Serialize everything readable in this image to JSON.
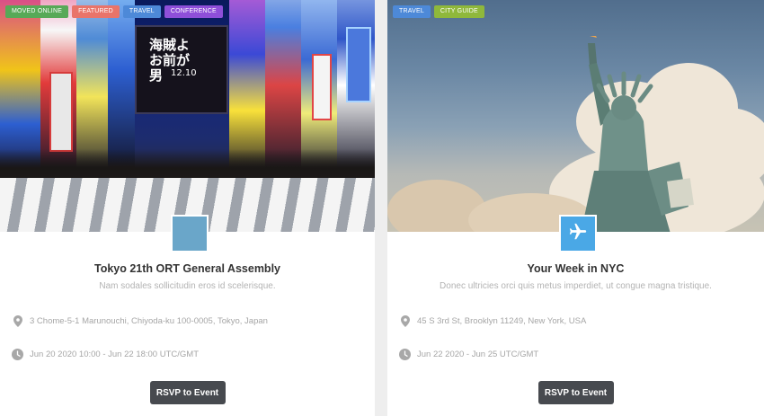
{
  "cards": [
    {
      "tags": [
        {
          "label": "MOVED ONLINE",
          "color": "#57a957"
        },
        {
          "label": "FEATURED",
          "color": "#e9746a"
        },
        {
          "label": "TRAVEL",
          "color": "#4d89d8"
        },
        {
          "label": "CONFERENCE",
          "color": "#8e4fd9"
        }
      ],
      "image_text": {
        "line1": "海賊よ",
        "line2": "お前が",
        "line3": "男",
        "number": "12.10"
      },
      "avatar_color": "#6aa6c9",
      "title": "Tokyo 21th ORT General Assembly",
      "subtitle": "Nam sodales sollicitudin eros id scelerisque.",
      "location": "3 Chome-5-1 Marunouchi, Chiyoda-ku 100-0005, Tokyo, Japan",
      "date": "Jun 20 2020 10:00 - Jun 22 18:00 UTC/GMT",
      "button_label": "RSVP to Event"
    },
    {
      "tags": [
        {
          "label": "TRAVEL",
          "color": "#4d89d8"
        },
        {
          "label": "CITY GUIDE",
          "color": "#8fb83b"
        }
      ],
      "avatar_color": "#4aa8e6",
      "avatar_icon": "airplane-icon",
      "title": "Your Week in NYC",
      "subtitle": "Donec ultricies orci quis metus imperdiet, ut congue magna tristique.",
      "location": "45 S 3rd St, Brooklyn 11249, New York, USA",
      "date": "Jun 22 2020 - Jun 25 UTC/GMT",
      "button_label": "RSVP to Event"
    }
  ]
}
